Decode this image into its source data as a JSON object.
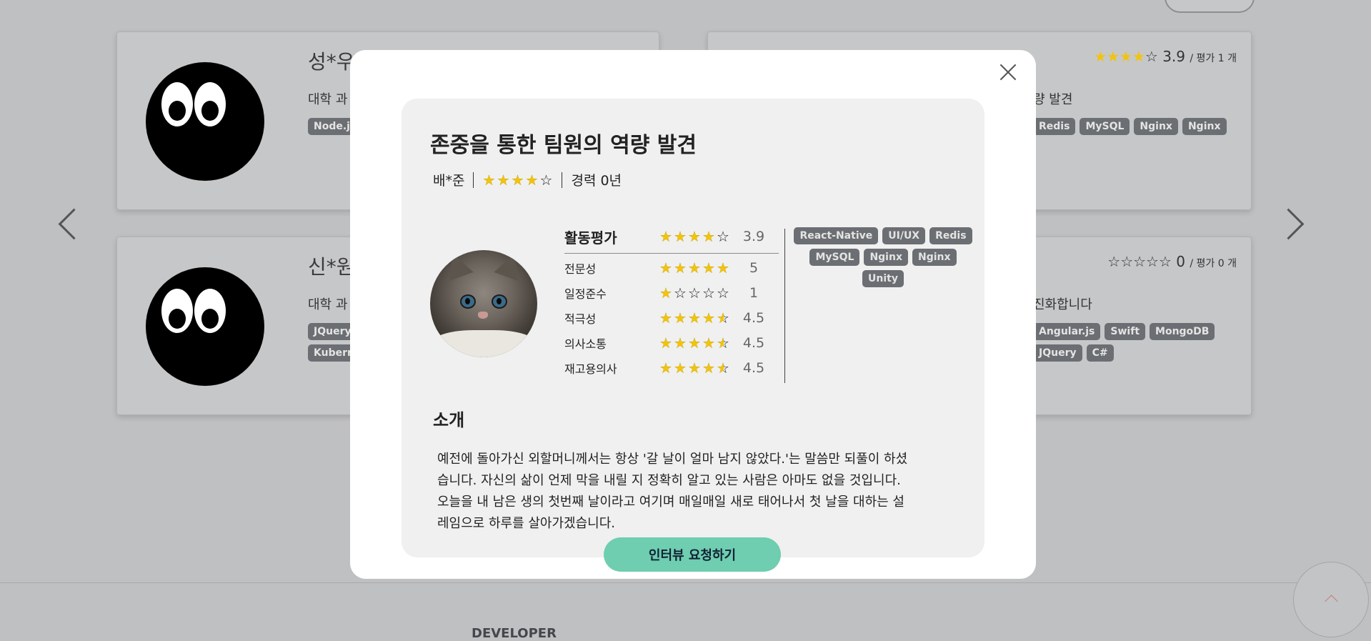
{
  "background": {
    "cards": [
      {
        "name": "성*우",
        "desc": "대학 과",
        "tags": [
          "Node.j"
        ]
      },
      {
        "rating": "3.9",
        "rating_count": "/ 평가 1 개",
        "desc_tail": "량 발견",
        "tags": [
          "Redis",
          "MySQL",
          "Nginx",
          "Nginx"
        ]
      },
      {
        "name": "신*원",
        "desc": "대학 과",
        "tags": [
          "JQuery",
          "Kubern"
        ]
      },
      {
        "rating": "0",
        "rating_count": "/ 평가 0 개",
        "desc_tail": "진화합니다",
        "tags": [
          "Angular.js",
          "Swift",
          "MongoDB",
          "JQuery",
          "C#"
        ]
      }
    ],
    "footer_label": "DEVELOPER"
  },
  "modal": {
    "title": "존중을 통한 팀원의 역량 발견",
    "author": "배*준",
    "author_rating": 4,
    "career": "경력 0년",
    "activity": {
      "label": "활동평가",
      "score": "3.9",
      "stars": 4,
      "rows": [
        {
          "label": "전문성",
          "value": "5",
          "stars": 5
        },
        {
          "label": "일정준수",
          "value": "1",
          "stars": 1
        },
        {
          "label": "적극성",
          "value": "4.5",
          "stars": 4.5
        },
        {
          "label": "의사소통",
          "value": "4.5",
          "stars": 4.5
        },
        {
          "label": "재고용의사",
          "value": "4.5",
          "stars": 4.5
        }
      ]
    },
    "skills": [
      "React-Native",
      "UI/UX",
      "Redis",
      "MySQL",
      "Nginx",
      "Nginx",
      "Unity"
    ],
    "intro_title": "소개",
    "intro_lines": [
      "예전에 돌아가신 외할머니께서는 항상 '갈 날이 얼마 남지 않았다.'는 말씀만 되풀이 하셨",
      "습니다. 자신의 삶이 언제 막을 내릴 지 정확히 알고 있는 사람은 아마도 없을 것입니다.",
      "오늘을 내 남은 생의 첫번째 날이라고 여기며 매일매일 새로 태어나서 첫 날을 대하는 설",
      "레임으로 하루를 살아가겠습니다."
    ],
    "interview_button": "인터뷰 요청하기"
  },
  "colors": {
    "star": "#f2c40a",
    "button": "#6fcdb0",
    "tag_bg": "#6b6e72"
  }
}
